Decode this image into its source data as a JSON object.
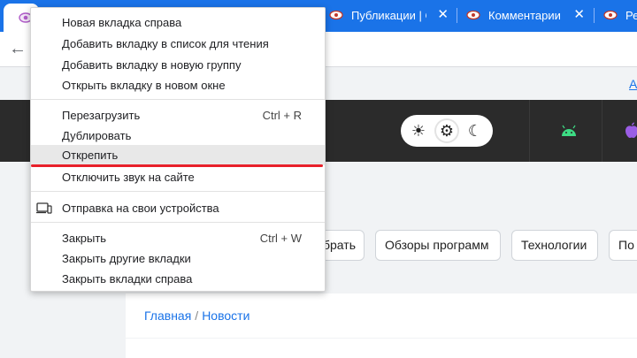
{
  "tabs": [
    {
      "title": "Публикации | Cl",
      "close": "✕"
    },
    {
      "title": "Комментарии П",
      "close": "✕"
    },
    {
      "title": "Ре",
      "close": ""
    }
  ],
  "toolbar": {
    "back": "←"
  },
  "bookmarks": {
    "corner_link": "A"
  },
  "theme": {
    "light": "☀",
    "auto": "⚙",
    "dark": "☾"
  },
  "chips": [
    "брать",
    "Обзоры программ",
    "Технологии",
    "По"
  ],
  "breadcrumb": {
    "home": "Главная",
    "separator": "/",
    "current": "Новости"
  },
  "context_menu": {
    "items": [
      {
        "label": "Новая вкладка справа",
        "shortcut": ""
      },
      {
        "label": "Добавить вкладку в список для чтения",
        "shortcut": ""
      },
      {
        "label": "Добавить вкладку в новую группу",
        "shortcut": ""
      },
      {
        "label": "Открыть вкладку в новом окне",
        "shortcut": ""
      },
      {
        "label": "Перезагрузить",
        "shortcut": "Ctrl + R"
      },
      {
        "label": "Дублировать",
        "shortcut": ""
      },
      {
        "label": "Открепить",
        "shortcut": "",
        "highlighted": true
      },
      {
        "label": "Отключить звук на сайте",
        "shortcut": ""
      },
      {
        "label": "Отправка на свои устройства",
        "shortcut": ""
      },
      {
        "label": "Закрыть",
        "shortcut": "Ctrl + W"
      },
      {
        "label": "Закрыть другие вкладки",
        "shortcut": ""
      },
      {
        "label": "Закрыть вкладки справа",
        "shortcut": ""
      }
    ]
  },
  "colors": {
    "tab_bar": "#1a73e8",
    "header": "#2b2b2b",
    "annotation": "#e8202a",
    "android": "#3ddc84",
    "apple": "#9b5de5"
  }
}
